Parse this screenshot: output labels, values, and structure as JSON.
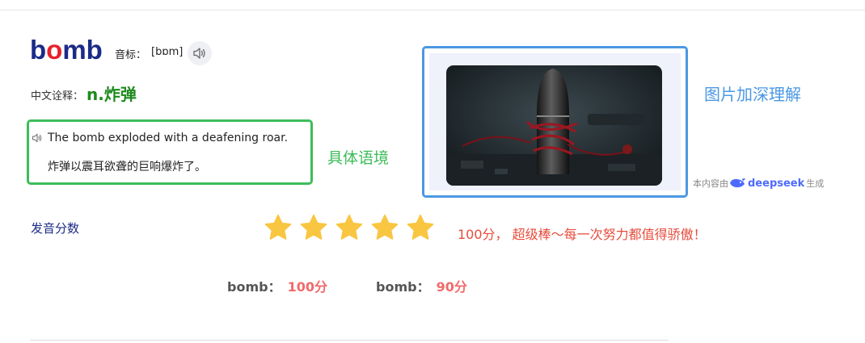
{
  "word": {
    "before": "b",
    "o": "o",
    "after": "mb"
  },
  "phonetic": {
    "label": "音标：",
    "value": "[bɒm]"
  },
  "definition": {
    "label": "中文诠释：",
    "value": "n.炸弹"
  },
  "example": {
    "en": "The bomb exploded with a deafening roar.",
    "cn": "炸弹以震耳欲聋的巨响爆炸了。",
    "context_label": "具体语境"
  },
  "image_section": {
    "label": "图片加深理解",
    "credit_prefix": "本内容由",
    "credit_brand": "deepseek",
    "credit_suffix": "生成"
  },
  "pronunciation": {
    "label": "发音分数",
    "stars": 5,
    "star_color": "#f9c642",
    "message": "100分， 超级棒～每一次努力都值得骄傲！"
  },
  "results": [
    {
      "word": "bomb：",
      "score": "100分"
    },
    {
      "word": "bomb：",
      "score": "90分"
    }
  ],
  "colors": {
    "brand_blue": "#1b2b86",
    "accent_red": "#e8202a",
    "green": "#3dbd5a",
    "blue": "#4b98e3"
  }
}
